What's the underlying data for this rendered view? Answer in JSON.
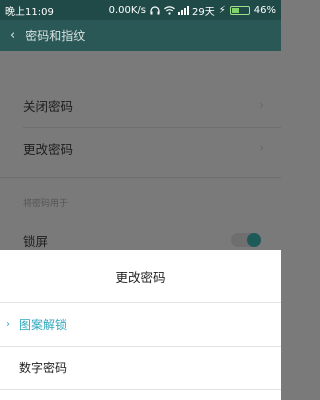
{
  "status": {
    "time": "晚上11:09",
    "speed": "0.00K/s",
    "date": "29天",
    "battery": "46%",
    "battery_level": 46
  },
  "header": {
    "title": "密码和指纹",
    "back_icon": "chevron-left-icon"
  },
  "settings": {
    "items": [
      {
        "label": "关闭密码"
      },
      {
        "label": "更改密码"
      }
    ],
    "section_label": "将密码用于",
    "lock_label": "锁屏"
  },
  "sheet": {
    "title": "更改密码",
    "options": [
      {
        "label": "图案解锁",
        "selected": true
      },
      {
        "label": "数字密码",
        "selected": false
      }
    ]
  },
  "colors": {
    "accent": "#2fa8bd",
    "header": "#2a5856"
  }
}
